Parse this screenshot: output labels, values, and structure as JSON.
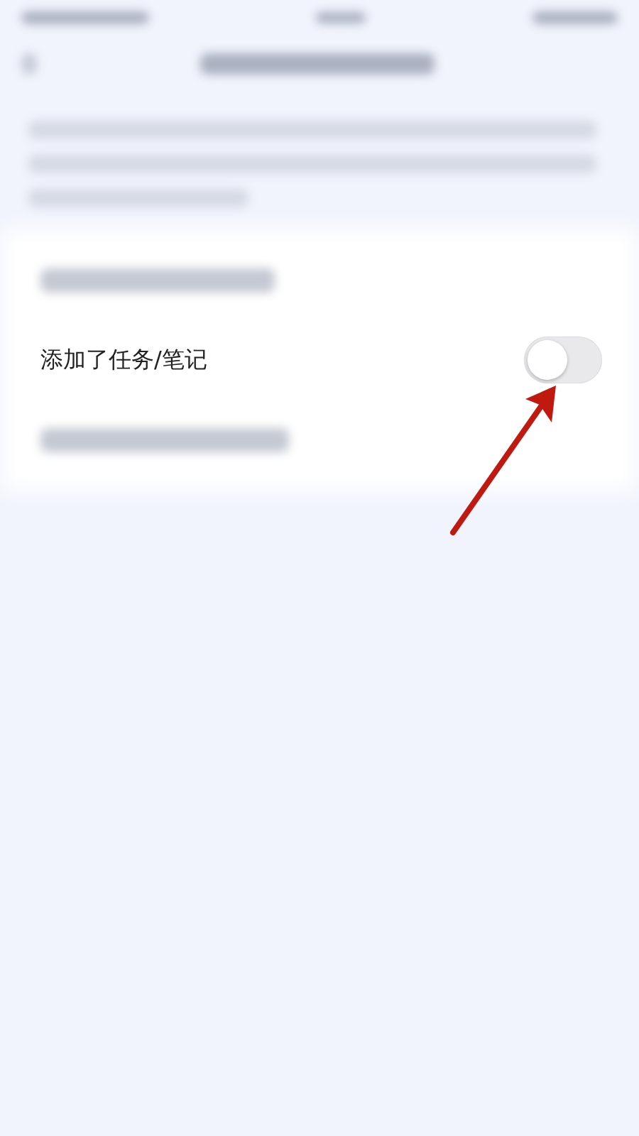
{
  "setting": {
    "label": "添加了任务/笔记",
    "on": false
  }
}
